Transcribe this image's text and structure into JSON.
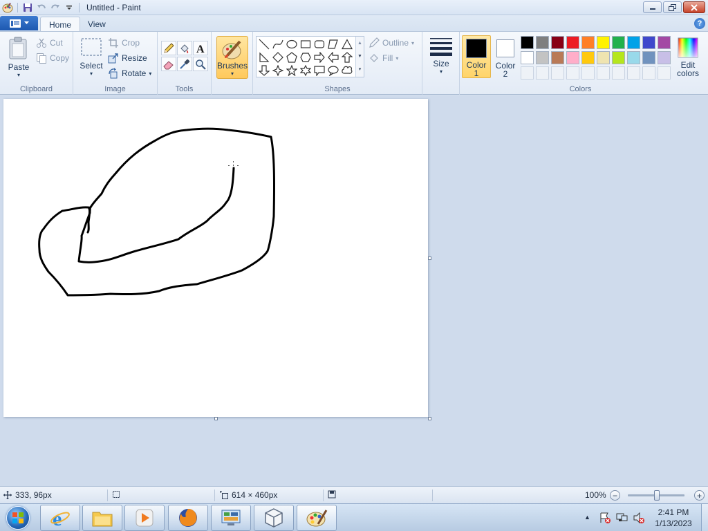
{
  "window": {
    "title": "Untitled - Paint"
  },
  "tabs": [
    {
      "label": "Home",
      "active": true
    },
    {
      "label": "View",
      "active": false
    }
  ],
  "groups": {
    "clipboard": {
      "label": "Clipboard",
      "paste": "Paste",
      "cut": "Cut",
      "copy": "Copy"
    },
    "image": {
      "label": "Image",
      "select": "Select",
      "crop": "Crop",
      "resize": "Resize",
      "rotate": "Rotate"
    },
    "tools": {
      "label": "Tools"
    },
    "brushes": {
      "label": "Brushes"
    },
    "shapes": {
      "label": "Shapes",
      "outline": "Outline",
      "fill": "Fill"
    },
    "size": {
      "label": "Size"
    },
    "colors": {
      "label": "Colors",
      "color1_line1": "Color",
      "color1_line2": "1",
      "color2_line1": "Color",
      "color2_line2": "2",
      "edit_line1": "Edit",
      "edit_line2": "colors",
      "color1_value": "#000000",
      "color2_value": "#ffffff",
      "palette": [
        "#000000",
        "#7f7f7f",
        "#880015",
        "#ed1c24",
        "#ff7f27",
        "#fff200",
        "#22b14c",
        "#00a2e8",
        "#3f48cc",
        "#a349a4",
        "#ffffff",
        "#c3c3c3",
        "#b97a57",
        "#ffaec9",
        "#ffc90e",
        "#efe4b0",
        "#b5e61d",
        "#99d9ea",
        "#7092be",
        "#c8bfe7"
      ]
    }
  },
  "status": {
    "cursor_position": "333, 96px",
    "canvas_size": "614 × 460px",
    "zoom": "100%",
    "zoom_percent": 100
  },
  "taskbar": {
    "apps": [
      "internet-explorer",
      "windows-explorer",
      "media-player",
      "firefox",
      "control-panel",
      "virtualbox",
      "paint"
    ],
    "time": "2:41 PM",
    "date": "1/13/2023"
  }
}
